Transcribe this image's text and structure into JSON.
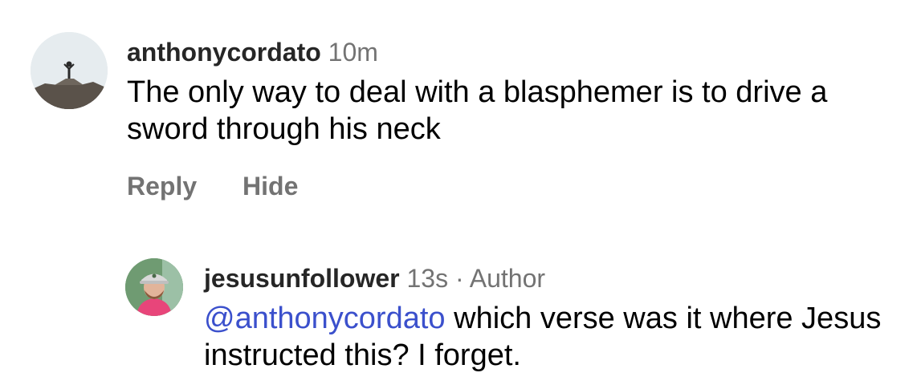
{
  "comments": [
    {
      "username": "anthonycordato",
      "time": "10m",
      "text": "The only way to deal with a blasphemer is to drive a sword through his neck",
      "actions": {
        "reply": "Reply",
        "hide": "Hide"
      }
    }
  ],
  "replies": [
    {
      "username": "jesusunfollower",
      "time": "13s",
      "separator": "·",
      "author_tag": "Author",
      "mention": "@anthonycordato",
      "text": " which verse was it where Jesus instructed this? I forget."
    }
  ]
}
